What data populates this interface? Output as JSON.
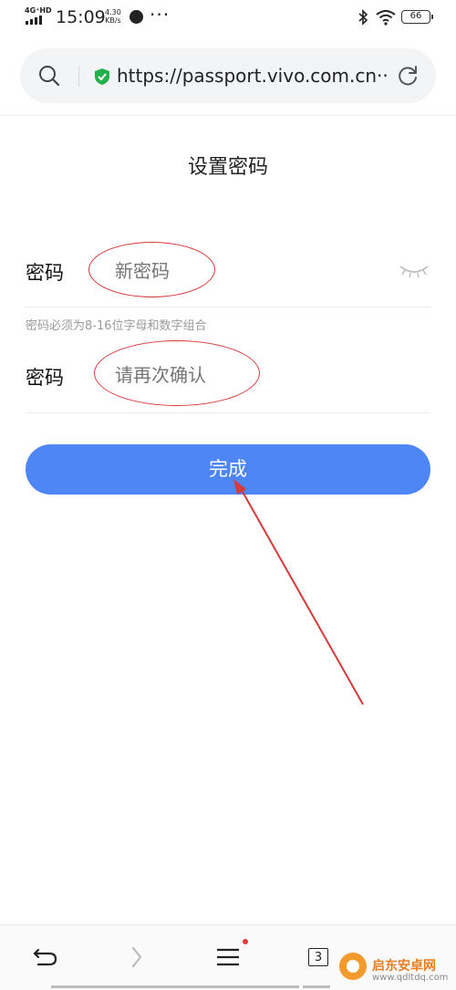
{
  "status_bar": {
    "network": "4G⁺HD",
    "time": "15:09",
    "speed_value": "4.30",
    "speed_unit": "KB/s",
    "battery": "66"
  },
  "browser": {
    "url": "https://passport.vivo.com.cn···"
  },
  "page": {
    "title": "设置密码",
    "password_label": "密码",
    "password_placeholder": "新密码",
    "hint": "密码必须为8-16位字母和数字组合",
    "confirm_label": "密码",
    "confirm_placeholder": "请再次确认",
    "done_label": "完成"
  },
  "toolbar": {
    "tab_count": "3"
  },
  "watermark": {
    "title": "启东安卓网",
    "url": "www.qdltdq.com"
  },
  "colors": {
    "accent": "#4e86f6",
    "annotation": "#d63a3a",
    "secure": "#22b14c"
  }
}
